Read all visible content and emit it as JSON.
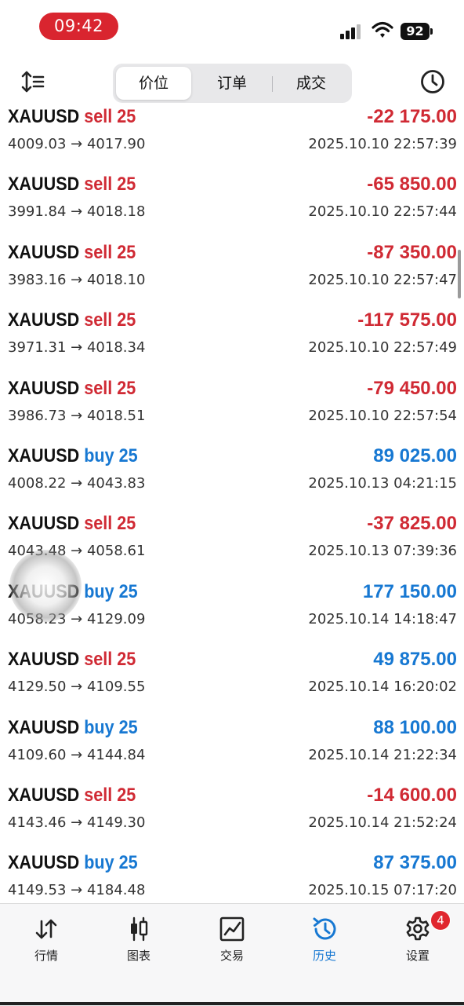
{
  "status_bar": {
    "time": "09:42",
    "battery": "92"
  },
  "header": {
    "segments": [
      {
        "label": "价位",
        "active": true
      },
      {
        "label": "订单",
        "active": false
      },
      {
        "label": "成交",
        "active": false
      }
    ]
  },
  "trades": [
    {
      "symbol": "XAUUSD",
      "side": "sell",
      "volume": "25",
      "prices": "4009.03 → 4017.90",
      "profit": "-22 175.00",
      "time": "2025.10.10 22:57:39"
    },
    {
      "symbol": "XAUUSD",
      "side": "sell",
      "volume": "25",
      "prices": "3991.84 → 4018.18",
      "profit": "-65 850.00",
      "time": "2025.10.10 22:57:44"
    },
    {
      "symbol": "XAUUSD",
      "side": "sell",
      "volume": "25",
      "prices": "3983.16 → 4018.10",
      "profit": "-87 350.00",
      "time": "2025.10.10 22:57:47"
    },
    {
      "symbol": "XAUUSD",
      "side": "sell",
      "volume": "25",
      "prices": "3971.31 → 4018.34",
      "profit": "-117 575.00",
      "time": "2025.10.10 22:57:49"
    },
    {
      "symbol": "XAUUSD",
      "side": "sell",
      "volume": "25",
      "prices": "3986.73 → 4018.51",
      "profit": "-79 450.00",
      "time": "2025.10.10 22:57:54"
    },
    {
      "symbol": "XAUUSD",
      "side": "buy",
      "volume": "25",
      "prices": "4008.22 → 4043.83",
      "profit": "89 025.00",
      "time": "2025.10.13 04:21:15"
    },
    {
      "symbol": "XAUUSD",
      "side": "sell",
      "volume": "25",
      "prices": "4043.48 → 4058.61",
      "profit": "-37 825.00",
      "time": "2025.10.13 07:39:36"
    },
    {
      "symbol": "XAUUSD",
      "side": "buy",
      "volume": "25",
      "prices": "4058.23 → 4129.09",
      "profit": "177 150.00",
      "time": "2025.10.14 14:18:47"
    },
    {
      "symbol": "XAUUSD",
      "side": "sell",
      "volume": "25",
      "prices": "4129.50 → 4109.55",
      "profit": "49 875.00",
      "time": "2025.10.14 16:20:02"
    },
    {
      "symbol": "XAUUSD",
      "side": "buy",
      "volume": "25",
      "prices": "4109.60 → 4144.84",
      "profit": "88 100.00",
      "time": "2025.10.14 21:22:34"
    },
    {
      "symbol": "XAUUSD",
      "side": "sell",
      "volume": "25",
      "prices": "4143.46 → 4149.30",
      "profit": "-14 600.00",
      "time": "2025.10.14 21:52:24"
    },
    {
      "symbol": "XAUUSD",
      "side": "buy",
      "volume": "25",
      "prices": "4149.53 → 4184.48",
      "profit": "87 375.00",
      "time": "2025.10.15 07:17:20"
    }
  ],
  "tabbar": {
    "items": [
      {
        "label": "行情",
        "icon": "quotes-arrows-icon",
        "active": false
      },
      {
        "label": "图表",
        "icon": "candlestick-chart-icon",
        "active": false
      },
      {
        "label": "交易",
        "icon": "trade-chart-icon",
        "active": false
      },
      {
        "label": "历史",
        "icon": "history-clock-icon",
        "active": true
      },
      {
        "label": "设置",
        "icon": "settings-gear-icon",
        "active": false,
        "badge": "4"
      }
    ]
  },
  "colors": {
    "sell": "#d02a34",
    "buy": "#1778d2",
    "accent": "#1778d2",
    "status_pill": "#d9252f"
  }
}
